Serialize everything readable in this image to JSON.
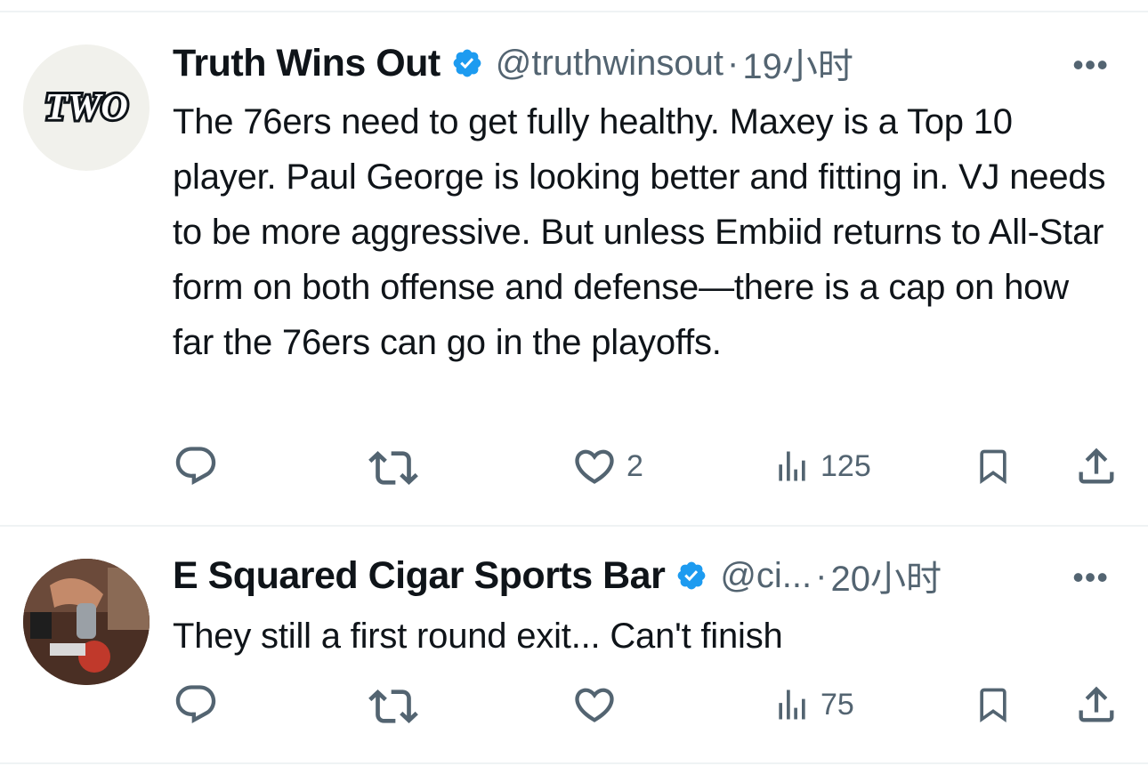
{
  "tweets": [
    {
      "name": "Truth Wins Out",
      "handle": "@truthwinsout",
      "separator": "·",
      "time": "19小时",
      "avatar_text": "TWO",
      "more": "•••",
      "text": "The 76ers need to get fully healthy. Maxey is a Top 10 player. Paul George is looking better and fitting in. VJ needs to be more aggressive. But unless Embiid returns to All-Star form on both offense and defense—there is a cap on how far the 76ers can go in the playoffs.",
      "likes": "2",
      "views": "125",
      "verified_color": "#1d9bf0"
    },
    {
      "name": "E Squared Cigar Sports Bar",
      "handle": "@ci...",
      "separator": "·",
      "time": "20小时",
      "more": "•••",
      "text": "They still a first round exit... Can't finish",
      "likes": "",
      "views": "75",
      "verified_color": "#1d9bf0"
    }
  ],
  "icons": {
    "reply": "reply-icon",
    "retweet": "retweet-icon",
    "like": "heart-icon",
    "views": "views-icon",
    "bookmark": "bookmark-icon",
    "share": "share-icon"
  },
  "colors": {
    "text": "#0f1419",
    "secondary": "#536471",
    "divider": "#eff3f4",
    "verified": "#1d9bf0"
  }
}
